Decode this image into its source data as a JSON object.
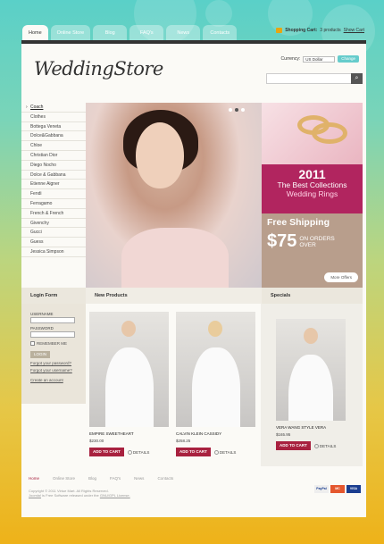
{
  "tabs": [
    "Home",
    "Online Store",
    "Blog",
    "FAQ's",
    "News",
    "Contacts"
  ],
  "cart": {
    "label": "Shopping Cart:",
    "count": "3 products",
    "link": "Show Cart"
  },
  "logo": {
    "part1": "Wedding",
    "part2": "Store"
  },
  "currency": {
    "label": "Currency:",
    "value": "US Dollar",
    "button": "Change"
  },
  "search": {
    "placeholder": ""
  },
  "categories": [
    "Coach",
    "Clothes",
    "Bottega Veneta",
    "Dolce&Gabbana",
    "Chloe",
    "Christian Dior",
    "Diego Nocho",
    "Dolce & Gabbana",
    "Etienne Aigner",
    "Fendi",
    "Ferragamo",
    "French & French",
    "Givenchy",
    "Gucci",
    "Guess",
    "Jessica Simpson"
  ],
  "banners": {
    "year": "2011",
    "best": "The Best Collections",
    "rings": "Wedding Rings",
    "free": "Free Shipping",
    "amount": "$75",
    "on": "ON ORDERS",
    "over": "OVER",
    "more": "More Offers"
  },
  "sections": {
    "login": "Login Form",
    "new": "New Products",
    "specials": "Specials"
  },
  "login": {
    "username": "USERNAME",
    "password": "PASSWORD",
    "remember": "REMEMBER ME",
    "button": "LOGIN",
    "forgot_pw": "Forgot your password?",
    "forgot_user": "Forgot your username?",
    "create": "Create an account"
  },
  "products": [
    {
      "name": "Empire Sweetheart",
      "price": "$230.00",
      "add": "ADD TO CART",
      "details": "DETAILS"
    },
    {
      "name": "Calvin Klein Cassidy",
      "price": "$258.25",
      "add": "ADD TO CART",
      "details": "DETAILS"
    },
    {
      "name": "Vera Wang Style Vera",
      "price": "$165.95",
      "add": "ADD TO CART",
      "details": "DETAILS"
    }
  ],
  "footer": {
    "nav": [
      "Home",
      "Online Store",
      "Blog",
      "FAQ's",
      "News",
      "Contacts"
    ],
    "copy1": "Copyright © 2011 Virtue Mart. All Rights Reserved.",
    "copy2a": "Joomla!",
    "copy2b": " is Free Software released under the ",
    "copy2c": "GNU/GPL License."
  },
  "payments": [
    "PayPal",
    "MC",
    "VISA"
  ],
  "colors": {
    "accent": "#a8213f",
    "banner_pink": "#b1255f",
    "banner_tan": "#b89e8c"
  }
}
